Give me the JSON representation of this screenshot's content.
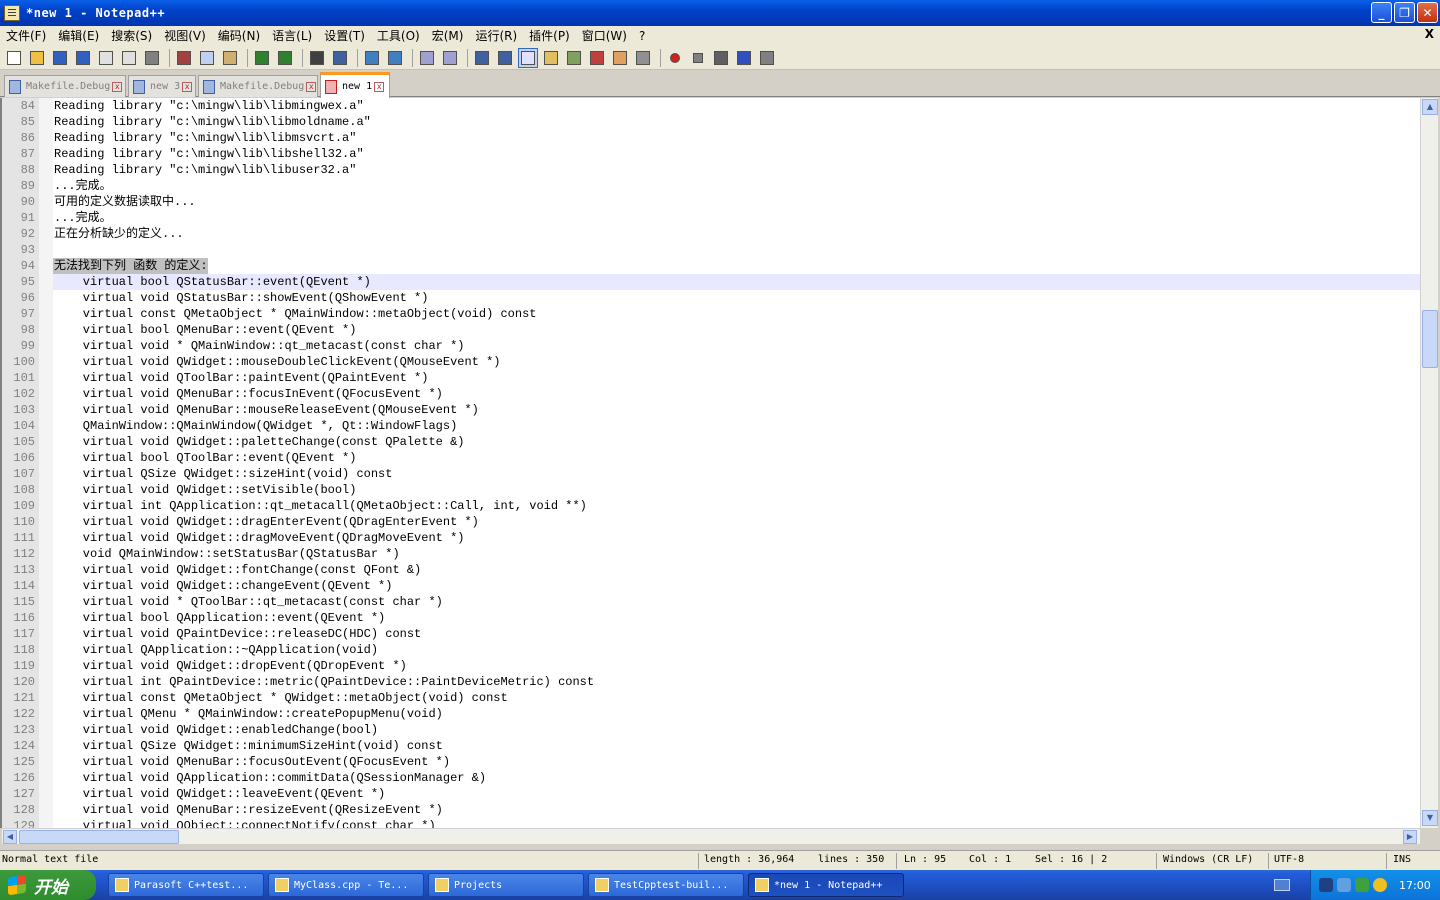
{
  "window": {
    "title": "*new 1 - Notepad++"
  },
  "menu": [
    "文件(F)",
    "编辑(E)",
    "搜索(S)",
    "视图(V)",
    "编码(N)",
    "语言(L)",
    "设置(T)",
    "工具(O)",
    "宏(M)",
    "运行(R)",
    "插件(P)",
    "窗口(W)",
    "?"
  ],
  "menu_close": "X",
  "toolbar_icons": [
    "new-file-icon",
    "open-file-icon",
    "save-icon",
    "save-all-icon",
    "close-icon",
    "close-all-icon",
    "print-icon",
    "cut-icon",
    "copy-icon",
    "paste-icon",
    "undo-icon",
    "redo-icon",
    "find-icon",
    "replace-icon",
    "zoom-in-icon",
    "zoom-out-icon",
    "sync-v-icon",
    "sync-h-icon",
    "word-wrap-icon",
    "show-all-chars-icon",
    "indent-guide-icon",
    "user-lang-icon",
    "doc-map-icon",
    "function-list-icon",
    "folder-icon",
    "monitor-icon",
    "record-macro-icon",
    "stop-macro-icon",
    "play-macro-icon",
    "run-macro-multiple-icon",
    "save-macro-icon"
  ],
  "tabs": [
    {
      "label": "Makefile.Debug",
      "active": false
    },
    {
      "label": "new 3",
      "active": false
    },
    {
      "label": "Makefile.Debug",
      "active": false
    },
    {
      "label": "new 1",
      "active": true
    }
  ],
  "editor": {
    "current_line": 95,
    "lines": [
      {
        "n": "84",
        "text": "Reading library \"c:\\mingw\\lib\\libmingwex.a\""
      },
      {
        "n": "85",
        "text": "Reading library \"c:\\mingw\\lib\\libmoldname.a\""
      },
      {
        "n": "86",
        "text": "Reading library \"c:\\mingw\\lib\\libmsvcrt.a\""
      },
      {
        "n": "87",
        "text": "Reading library \"c:\\mingw\\lib\\libshell32.a\""
      },
      {
        "n": "88",
        "text": "Reading library \"c:\\mingw\\lib\\libuser32.a\""
      },
      {
        "n": "89",
        "text": "...完成。"
      },
      {
        "n": "90",
        "text": "可用的定义数据读取中..."
      },
      {
        "n": "91",
        "text": "...完成。"
      },
      {
        "n": "92",
        "text": "正在分析缺少的定义..."
      },
      {
        "n": "93",
        "text": ""
      },
      {
        "n": "94",
        "text": "无法找到下列 函数 的定义:",
        "selected": true
      },
      {
        "n": "95",
        "text": "    virtual bool QStatusBar::event(QEvent *)"
      },
      {
        "n": "96",
        "text": "    virtual void QStatusBar::showEvent(QShowEvent *)"
      },
      {
        "n": "97",
        "text": "    virtual const QMetaObject * QMainWindow::metaObject(void) const"
      },
      {
        "n": "98",
        "text": "    virtual bool QMenuBar::event(QEvent *)"
      },
      {
        "n": "99",
        "text": "    virtual void * QMainWindow::qt_metacast(const char *)"
      },
      {
        "n": "100",
        "text": "    virtual void QWidget::mouseDoubleClickEvent(QMouseEvent *)"
      },
      {
        "n": "101",
        "text": "    virtual void QToolBar::paintEvent(QPaintEvent *)"
      },
      {
        "n": "102",
        "text": "    virtual void QMenuBar::focusInEvent(QFocusEvent *)"
      },
      {
        "n": "103",
        "text": "    virtual void QMenuBar::mouseReleaseEvent(QMouseEvent *)"
      },
      {
        "n": "104",
        "text": "    QMainWindow::QMainWindow(QWidget *, Qt::WindowFlags)"
      },
      {
        "n": "105",
        "text": "    virtual void QWidget::paletteChange(const QPalette &)"
      },
      {
        "n": "106",
        "text": "    virtual bool QToolBar::event(QEvent *)"
      },
      {
        "n": "107",
        "text": "    virtual QSize QWidget::sizeHint(void) const"
      },
      {
        "n": "108",
        "text": "    virtual void QWidget::setVisible(bool)"
      },
      {
        "n": "109",
        "text": "    virtual int QApplication::qt_metacall(QMetaObject::Call, int, void **)"
      },
      {
        "n": "110",
        "text": "    virtual void QWidget::dragEnterEvent(QDragEnterEvent *)"
      },
      {
        "n": "111",
        "text": "    virtual void QWidget::dragMoveEvent(QDragMoveEvent *)"
      },
      {
        "n": "112",
        "text": "    void QMainWindow::setStatusBar(QStatusBar *)"
      },
      {
        "n": "113",
        "text": "    virtual void QWidget::fontChange(const QFont &)"
      },
      {
        "n": "114",
        "text": "    virtual void QWidget::changeEvent(QEvent *)"
      },
      {
        "n": "115",
        "text": "    virtual void * QToolBar::qt_metacast(const char *)"
      },
      {
        "n": "116",
        "text": "    virtual bool QApplication::event(QEvent *)"
      },
      {
        "n": "117",
        "text": "    virtual void QPaintDevice::releaseDC(HDC) const"
      },
      {
        "n": "118",
        "text": "    virtual QApplication::~QApplication(void)"
      },
      {
        "n": "119",
        "text": "    virtual void QWidget::dropEvent(QDropEvent *)"
      },
      {
        "n": "120",
        "text": "    virtual int QPaintDevice::metric(QPaintDevice::PaintDeviceMetric) const"
      },
      {
        "n": "121",
        "text": "    virtual const QMetaObject * QWidget::metaObject(void) const"
      },
      {
        "n": "122",
        "text": "    virtual QMenu * QMainWindow::createPopupMenu(void)"
      },
      {
        "n": "123",
        "text": "    virtual void QWidget::enabledChange(bool)"
      },
      {
        "n": "124",
        "text": "    virtual QSize QWidget::minimumSizeHint(void) const"
      },
      {
        "n": "125",
        "text": "    virtual void QMenuBar::focusOutEvent(QFocusEvent *)"
      },
      {
        "n": "126",
        "text": "    virtual void QApplication::commitData(QSessionManager &)"
      },
      {
        "n": "127",
        "text": "    virtual void QWidget::leaveEvent(QEvent *)"
      },
      {
        "n": "128",
        "text": "    virtual void QMenuBar::resizeEvent(QResizeEvent *)"
      },
      {
        "n": "129",
        "text": "    virtual void QObject::connectNotify(const char *)"
      }
    ]
  },
  "status": {
    "file_type": "Normal text file",
    "length": "length : 36,964",
    "lines": "lines : 350",
    "ln": "Ln : 95",
    "col": "Col : 1",
    "sel": "Sel : 16 | 2",
    "eol": "Windows (CR LF)",
    "encoding": "UTF-8",
    "mode": "INS"
  },
  "taskbar": {
    "start_label": "开始",
    "tasks": [
      {
        "label": "Parasoft C++test...",
        "active": false
      },
      {
        "label": "MyClass.cpp - Te...",
        "active": false
      },
      {
        "label": "Projects",
        "active": false
      },
      {
        "label": "TestCpptest-buil...",
        "active": false
      },
      {
        "label": "*new 1 - Notepad++",
        "active": true
      }
    ],
    "clock": "17:00"
  }
}
